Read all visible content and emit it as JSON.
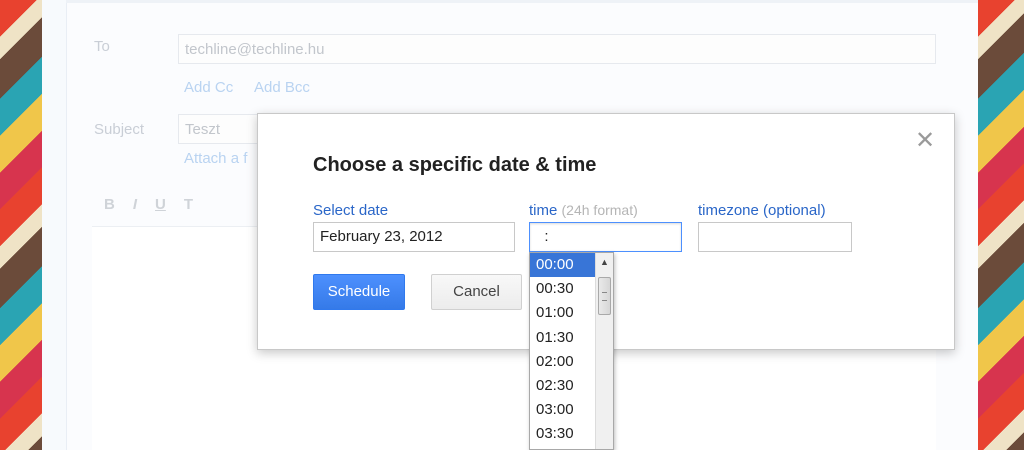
{
  "compose": {
    "to_label": "To",
    "to_value": "techline@techline.hu",
    "add_cc": "Add Cc",
    "add_bcc": "Add Bcc",
    "subject_label": "Subject",
    "subject_value": "Teszt",
    "attach_label": "Attach a f",
    "toolbar": [
      "B",
      "I",
      "U",
      "T"
    ]
  },
  "dialog": {
    "title": "Choose a specific date & time",
    "close_icon": "close-icon",
    "date_label": "Select date",
    "date_value": "February 23, 2012",
    "time_label": "time",
    "time_hint": "(24h format)",
    "time_value": "  :",
    "timezone_label": "timezone (optional)",
    "timezone_value": "",
    "schedule_button": "Schedule",
    "cancel_button": "Cancel"
  },
  "time_options": {
    "selected": "00:00",
    "items": [
      "00:00",
      "00:30",
      "01:00",
      "01:30",
      "02:00",
      "02:30",
      "03:00",
      "03:30"
    ]
  },
  "colors": {
    "accent": "#4d90fe",
    "link": "#2a66c8",
    "selected_row": "#3875d7"
  }
}
